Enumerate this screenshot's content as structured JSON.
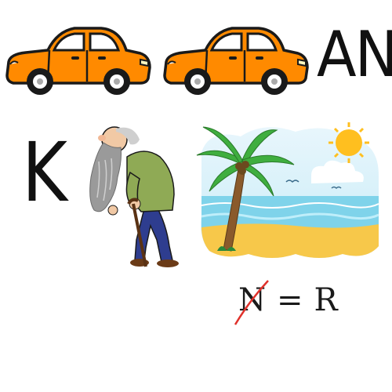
{
  "puzzle": {
    "letters_top": "AN",
    "letter_left": "K",
    "rule": {
      "removed": "N",
      "equals": "=",
      "added": "R"
    }
  },
  "colors": {
    "car_body": "#ff8a00",
    "car_outline": "#1a1a1a",
    "strike": "#e0312b",
    "sea": "#7fd3ea",
    "sand": "#f7c84a",
    "sun": "#ffbf1f",
    "palm": "#3fae3f"
  },
  "icons": [
    "car-icon",
    "car-icon",
    "old-man-icon",
    "beach-palm-icon"
  ]
}
